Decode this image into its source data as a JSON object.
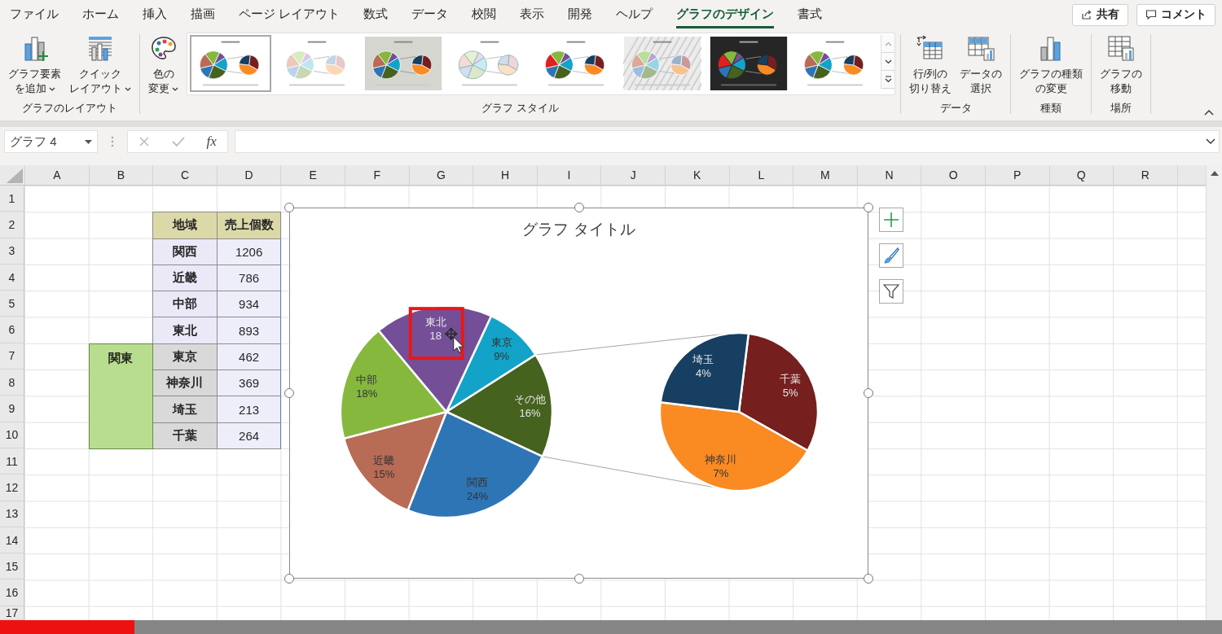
{
  "tabs": [
    {
      "label": "ファイル",
      "selected": false
    },
    {
      "label": "ホーム",
      "selected": false
    },
    {
      "label": "挿入",
      "selected": false
    },
    {
      "label": "描画",
      "selected": false
    },
    {
      "label": "ページ レイアウト",
      "selected": false
    },
    {
      "label": "数式",
      "selected": false
    },
    {
      "label": "データ",
      "selected": false
    },
    {
      "label": "校閲",
      "selected": false
    },
    {
      "label": "表示",
      "selected": false
    },
    {
      "label": "開発",
      "selected": false
    },
    {
      "label": "ヘルプ",
      "selected": false
    },
    {
      "label": "グラフのデザイン",
      "selected": true
    },
    {
      "label": "書式",
      "selected": false
    }
  ],
  "top_buttons": [
    {
      "kind": "share",
      "label": "共有"
    },
    {
      "kind": "comment",
      "label": "コメント"
    }
  ],
  "ribbon": {
    "groups": [
      {
        "label": "グラフのレイアウト",
        "buttons": [
          {
            "kind": "add-element",
            "label": [
              "グラフ要素",
              "を追加"
            ],
            "menu": true
          },
          {
            "kind": "quick-layout",
            "label": [
              "クイック",
              "レイアウト"
            ],
            "menu": true
          }
        ]
      },
      {
        "label": "グラフ スタイル",
        "buttons": [
          {
            "kind": "palette",
            "label": [
              "色の",
              "変更"
            ],
            "menu": true
          }
        ],
        "styles": [
          {
            "kind": "plain",
            "selected": true
          },
          {
            "kind": "pattern",
            "selected": false
          },
          {
            "kind": "gradient",
            "selected": false
          },
          {
            "kind": "pastel",
            "selected": false
          },
          {
            "kind": "bold",
            "selected": false
          },
          {
            "kind": "hatched",
            "selected": false
          },
          {
            "kind": "dark",
            "selected": false
          },
          {
            "kind": "outlined",
            "selected": false
          }
        ]
      },
      {
        "label": "データ",
        "buttons": [
          {
            "kind": "switch",
            "label": [
              "行/列の",
              "切り替え"
            ],
            "menu": false
          },
          {
            "kind": "select-data",
            "label": [
              "データの",
              "選択"
            ],
            "menu": false
          }
        ]
      },
      {
        "label": "種類",
        "buttons": [
          {
            "kind": "chart-type",
            "label": [
              "グラフの種類",
              "の変更"
            ],
            "menu": false
          }
        ]
      },
      {
        "label": "場所",
        "buttons": [
          {
            "kind": "move-chart",
            "label": [
              "グラフの",
              "移動"
            ],
            "menu": false
          }
        ]
      }
    ]
  },
  "formula_bar": {
    "name_box": "グラフ 4",
    "function_button": "fx"
  },
  "columns": [
    "A",
    "B",
    "C",
    "D",
    "E",
    "F",
    "G",
    "H",
    "I",
    "J",
    "K",
    "L",
    "M",
    "N",
    "O",
    "P",
    "Q",
    "R"
  ],
  "rows": [
    "1",
    "2",
    "3",
    "4",
    "5",
    "6",
    "7",
    "8",
    "9",
    "10",
    "11",
    "12",
    "13",
    "14",
    "15",
    "16",
    "17"
  ],
  "table": {
    "header": [
      "地域",
      "売上個数"
    ],
    "group_label": "関東",
    "rows": [
      {
        "region": "関西",
        "sales": "1206",
        "kind": "plain"
      },
      {
        "region": "近畿",
        "sales": "786",
        "kind": "plain"
      },
      {
        "region": "中部",
        "sales": "934",
        "kind": "plain"
      },
      {
        "region": "東北",
        "sales": "893",
        "kind": "plain"
      },
      {
        "region": "東京",
        "sales": "462",
        "kind": "sub"
      },
      {
        "region": "神奈川",
        "sales": "369",
        "kind": "sub"
      },
      {
        "region": "埼玉",
        "sales": "213",
        "kind": "sub"
      },
      {
        "region": "千葉",
        "sales": "264",
        "kind": "sub"
      }
    ]
  },
  "chart": {
    "title": "グラフ タイトル",
    "main": {
      "highlighted": [
        false,
        false,
        false,
        false,
        false,
        true
      ],
      "chart_data": {
        "type": "pie",
        "categories": [
          "東京",
          "その他",
          "関西",
          "近畿",
          "中部",
          "東北"
        ],
        "values": [
          9,
          16,
          24,
          15,
          18,
          18
        ],
        "value_labels": [
          "9%",
          "16%",
          "24%",
          "15%",
          "18%",
          "18"
        ],
        "colors": [
          "#13a3c9",
          "#45621f",
          "#2e75b6",
          "#b86b55",
          "#86b83e",
          "#744f97"
        ]
      }
    },
    "secondary": {
      "chart_data": {
        "type": "pie",
        "categories": [
          "千葉",
          "神奈川",
          "埼玉"
        ],
        "values": [
          5,
          7,
          4
        ],
        "value_labels": [
          "5%",
          "7%",
          "4%"
        ],
        "colors": [
          "#761f1f",
          "#fa8a22",
          "#163f61"
        ]
      }
    }
  },
  "video": {
    "level": 0.11
  }
}
